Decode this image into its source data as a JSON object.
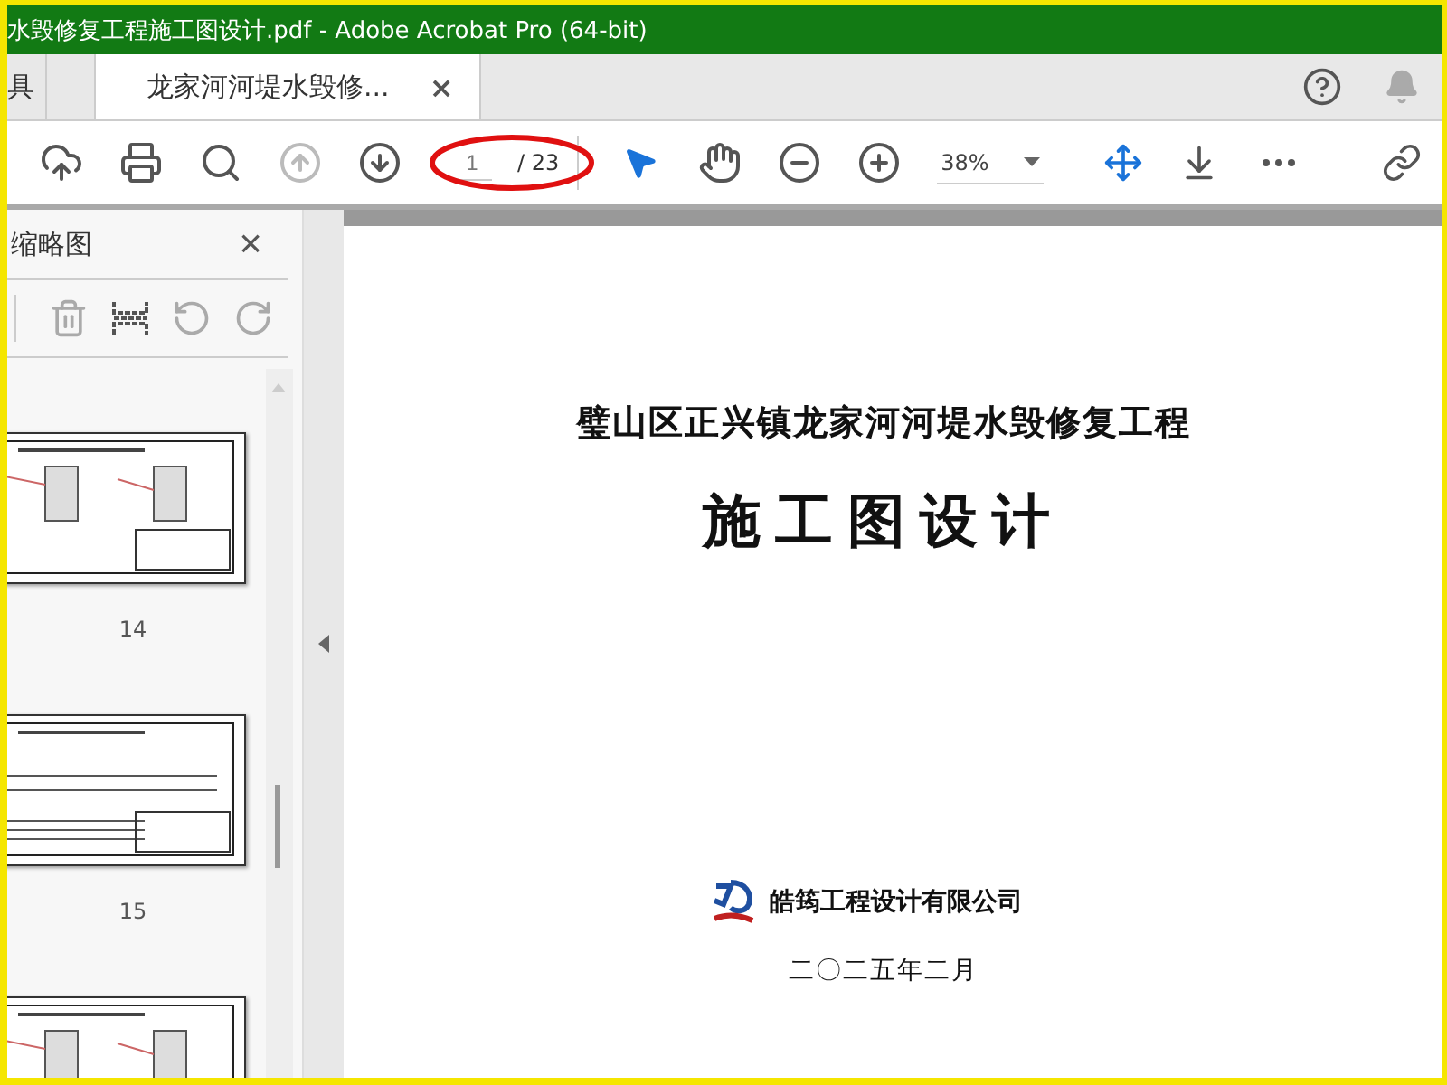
{
  "window": {
    "title": "水毁修复工程施工图设计.pdf - Adobe Acrobat Pro (64-bit)"
  },
  "tabs": [
    {
      "label": "具",
      "selected": false
    },
    {
      "label": "龙家河河堤水毁修...",
      "selected": true,
      "close": "×"
    }
  ],
  "toolbar": {
    "buttons": [
      {
        "kind": "upload",
        "disabled": false
      },
      {
        "kind": "print",
        "disabled": false
      },
      {
        "kind": "search",
        "disabled": false
      },
      {
        "kind": "prev",
        "disabled": true
      },
      {
        "kind": "next",
        "disabled": false
      }
    ],
    "page_field": {
      "value": "1",
      "total": "/ 23"
    },
    "zoom": {
      "value": "38%"
    }
  },
  "thumbnails_panel": {
    "title": "缩略图",
    "close": "×",
    "pages": [
      {
        "kind": "full",
        "label": "14"
      },
      {
        "kind": "full",
        "label": "15"
      },
      {
        "kind": "partial"
      }
    ]
  },
  "document": {
    "heading": "璧山区正兴镇龙家河河堤水毁修复工程",
    "title": "施工图设计",
    "company": "皓筠工程设计有限公司",
    "date": "二〇二五年二月"
  }
}
